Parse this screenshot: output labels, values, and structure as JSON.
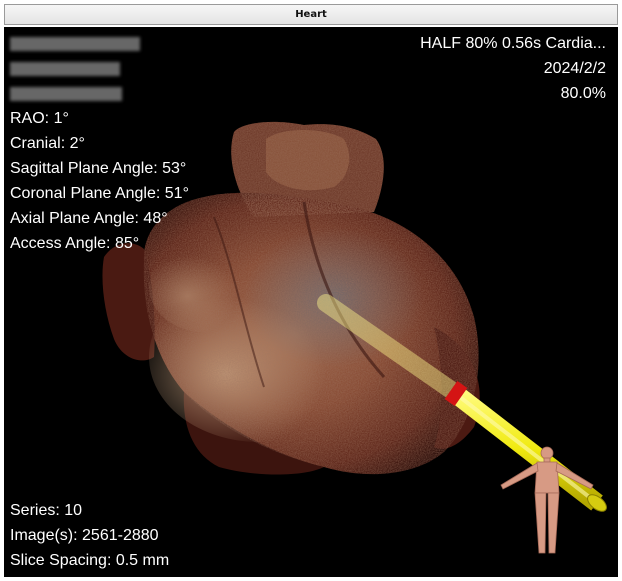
{
  "window": {
    "title": "Heart"
  },
  "overlay": {
    "top_right": [
      "HALF 80% 0.56s Cardia...",
      "2024/2/2",
      "80.0%"
    ],
    "angles": [
      "RAO: 1°",
      "Cranial: 2°",
      "Sagittal Plane Angle: 53°",
      "Coronal Plane Angle: 51°",
      "Axial Plane Angle: 48°",
      "Access Angle: 85°"
    ],
    "series": [
      "Series: 10",
      "Image(s): 2561-2880",
      "Slice Spacing: 0.5 mm"
    ]
  },
  "colors": {
    "background": "#000000",
    "text": "#ffffff",
    "needle": "#f2ee1a",
    "needle_ring": "#d41414",
    "tissue": "#7a3e2a",
    "figure": "#d79a84"
  },
  "icons": {
    "orientation": "human-figure-icon",
    "instrument": "needle-trajectory-icon"
  }
}
